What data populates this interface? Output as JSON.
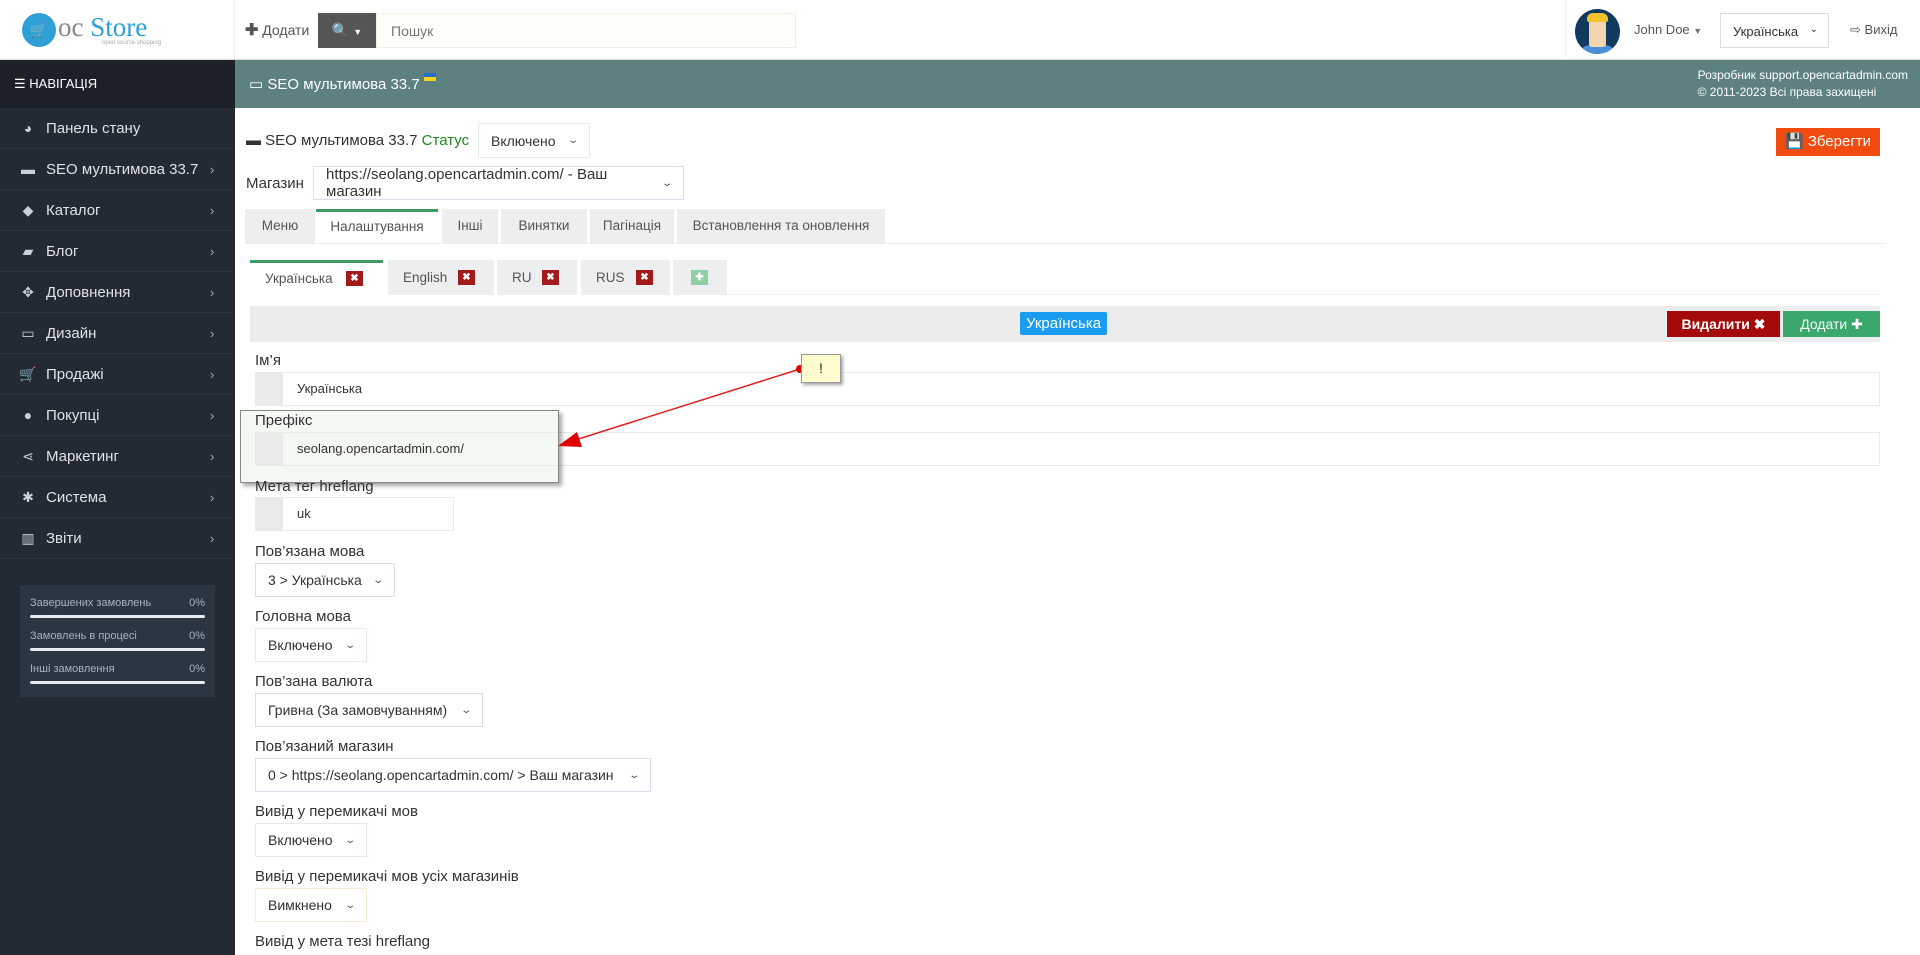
{
  "header": {
    "logo_text_oc": "oc",
    "logo_text_store": "Store",
    "logo_sub": "open source shopping",
    "add_label": "Додати",
    "search_placeholder": "Пошук",
    "user_name": "John Doe",
    "language": "Українська",
    "logout": "Вихід"
  },
  "sidebar": {
    "nav_title": "НАВІГАЦІЯ",
    "items": [
      {
        "label": "Панель стану",
        "icon": "dashboard-icon"
      },
      {
        "label": "SEO мультимова 33.7",
        "icon": "credit-card-icon"
      },
      {
        "label": "Каталог",
        "icon": "tags-icon"
      },
      {
        "label": "Блог",
        "icon": "book-icon"
      },
      {
        "label": "Доповнення",
        "icon": "puzzle-icon"
      },
      {
        "label": "Дизайн",
        "icon": "desktop-icon"
      },
      {
        "label": "Продажі",
        "icon": "cart-icon"
      },
      {
        "label": "Покупці",
        "icon": "user-icon"
      },
      {
        "label": "Маркетинг",
        "icon": "share-icon"
      },
      {
        "label": "Система",
        "icon": "gear-icon"
      },
      {
        "label": "Звіти",
        "icon": "bar-chart-icon"
      }
    ],
    "stats": [
      {
        "label": "Завершених замовлень",
        "value": "0%",
        "progress": 0
      },
      {
        "label": "Замовлень в процесі",
        "value": "0%",
        "progress": 0
      },
      {
        "label": "Інші замовлення",
        "value": "0%",
        "progress": 0
      }
    ]
  },
  "titlebar": {
    "title": "SEO мультимова 33.7",
    "developer": "Розробник support.opencartadmin.com",
    "copyright": "© 2011-2023 Всі права захищені"
  },
  "main": {
    "module_title": "SEO мультимова 33.7",
    "status_label": "Статус",
    "status_value": "Включено",
    "save_label": "Зберегти",
    "store_label": "Магазин",
    "store_value": "https://seolang.opencartadmin.com/ - Ваш магазин",
    "tabs": [
      "Меню",
      "Налаштування",
      "Інші",
      "Винятки",
      "Пагінація",
      "Встановлення та оновлення"
    ],
    "lang_tabs": [
      "Українська",
      "English",
      "RU",
      "RUS"
    ],
    "current_lang": "Українська",
    "delete_label": "Видалити",
    "add_label": "Додати",
    "fields": {
      "name_label": "Ім’я",
      "name_value": "Українська",
      "prefix_label": "Префікс",
      "prefix_value": "seolang.opencartadmin.com/",
      "hreflang_label": "Мета тег hreflang",
      "hreflang_value": "uk",
      "linked_lang_label": "Пов’язана мова",
      "linked_lang_value": "3 > Українська",
      "main_lang_label": "Головна мова",
      "main_lang_value": "Включено",
      "currency_label": "Пов’зана валюта",
      "currency_value": "Гривна (За замовчуванням)",
      "linked_store_label": "Пов’язаний магазин",
      "linked_store_value": "0 > https://seolang.opencartadmin.com/ > Ваш магазин",
      "switcher_label": "Вивід у перемикачі мов",
      "switcher_value": "Включено",
      "switcher_all_label": "Вивід у перемикачі мов усіх магазинів",
      "switcher_all_value": "Вимкнено",
      "hreflang_out_label": "Вивід у мета тезі hreflang"
    }
  },
  "annotation": {
    "note_text": "!"
  }
}
